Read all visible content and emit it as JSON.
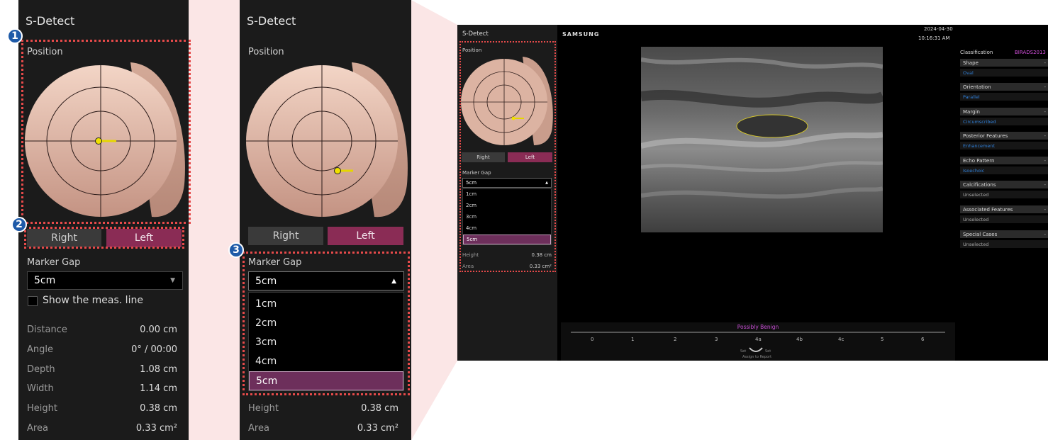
{
  "panel1": {
    "title": "S-Detect",
    "position_label": "Position",
    "right_label": "Right",
    "left_label": "Left",
    "marker_gap_label": "Marker Gap",
    "marker_gap_value": "5cm",
    "show_meas_line": "Show the meas. line",
    "measurements": [
      {
        "label": "Distance",
        "value": "0.00 cm"
      },
      {
        "label": "Angle",
        "value": "0° / 00:00"
      },
      {
        "label": "Depth",
        "value": "1.08 cm"
      },
      {
        "label": "Width",
        "value": "1.14 cm"
      },
      {
        "label": "Height",
        "value": "0.38 cm"
      },
      {
        "label": "Area",
        "value": "0.33 cm²"
      }
    ]
  },
  "panel2": {
    "title": "S-Detect",
    "position_label": "Position",
    "right_label": "Right",
    "left_label": "Left",
    "marker_gap_label": "Marker Gap",
    "marker_gap_value": "5cm",
    "options": [
      "1cm",
      "2cm",
      "3cm",
      "4cm",
      "5cm"
    ],
    "selected_option": "5cm",
    "measurements": [
      {
        "label": "Height",
        "value": "0.38 cm"
      },
      {
        "label": "Area",
        "value": "0.33 cm²"
      }
    ]
  },
  "badges": [
    "1",
    "2",
    "3"
  ],
  "mini": {
    "title": "S-Detect",
    "brand": "SAMSUNG",
    "date": "2024-04-30",
    "time": "10:16:31 AM",
    "position_label": "Position",
    "right_label": "Right",
    "left_label": "Left",
    "marker_gap_label": "Marker Gap",
    "marker_gap_value": "5cm",
    "options": [
      "1cm",
      "2cm",
      "3cm",
      "4cm",
      "5cm"
    ],
    "measurements": [
      {
        "label": "Height",
        "value": "0.38 cm"
      },
      {
        "label": "Area",
        "value": "0.33 cm²"
      }
    ],
    "classification_label": "Classification",
    "classification_system": "BIRADS2013",
    "categories": [
      {
        "name": "Shape",
        "value": "Oval"
      },
      {
        "name": "Orientation",
        "value": "Parallel"
      },
      {
        "name": "Margin",
        "value": "Circumscribed"
      },
      {
        "name": "Posterior Features",
        "value": "Enhancement"
      },
      {
        "name": "Echo Pattern",
        "value": "Isoechoic"
      },
      {
        "name": "Calcifications",
        "value": "Unselected"
      },
      {
        "name": "Associated Features",
        "value": "Unselected"
      },
      {
        "name": "Special Cases",
        "value": "Unselected"
      }
    ],
    "result": "Possibly Benign",
    "scale": [
      "0",
      "1",
      "2",
      "3",
      "4a",
      "4b",
      "4c",
      "5",
      "6"
    ],
    "set_left": "Set",
    "set_right": "Set",
    "assign": "Assign to Report"
  },
  "colors": {
    "panel_bg": "#1b1b1b",
    "accent": "#8a2c55",
    "selected_option": "#6d2f5b",
    "highlight_box": "#e64a4a",
    "badge": "#1e5aa8",
    "result_text": "#c94fd6",
    "category_value": "#2f7fd8"
  }
}
